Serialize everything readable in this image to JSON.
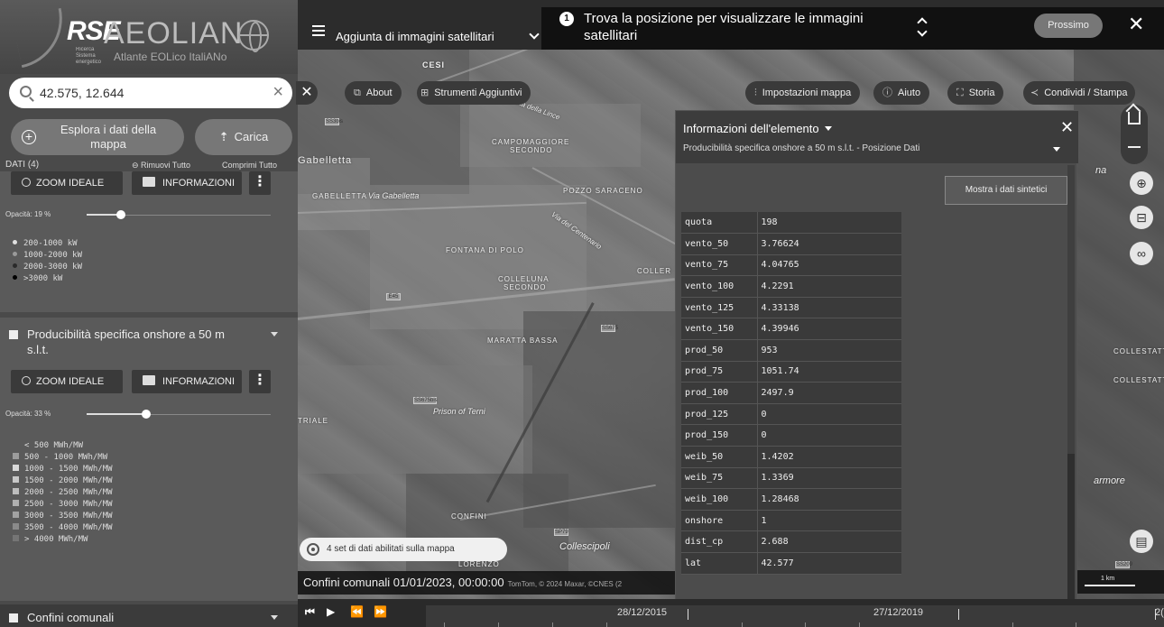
{
  "logo": {
    "brand": "RSE",
    "name": "AEOLIAN",
    "subtitle": "Atlante EOLico ItaliANo",
    "tagline": "Ricerca Sistema energetico"
  },
  "search": {
    "value": "42.575, 12.644",
    "clear_icon": "close-icon"
  },
  "actions": {
    "explore_label": "Esplora i dati della mappa",
    "upload_label": "Carica"
  },
  "data_header": {
    "count_label": "DATI (4)",
    "remove_all": "Rimuovi Tutto",
    "collapse_all": "Comprimi Tutto"
  },
  "layers": [
    {
      "zoom_label": "ZOOM IDEALE",
      "info_label": "INFORMAZIONI",
      "opacity_label": "Opacità: 19 %",
      "opacity": 0.19,
      "legend": [
        {
          "label": "200-1000 kW",
          "color": "#e0e0e0"
        },
        {
          "label": "1000-2000 kW",
          "color": "#9a9a9a"
        },
        {
          "label": "2000-3000 kW",
          "color": "#555555"
        },
        {
          "label": ">3000 kW",
          "color": "#111111"
        }
      ]
    },
    {
      "title": "Producibilità specifica onshore a 50 m s.l.t.",
      "zoom_label": "ZOOM IDEALE",
      "info_label": "INFORMAZIONI",
      "opacity_label": "Opacità: 33 %",
      "opacity": 0.33,
      "legend": [
        {
          "label": "< 500 MWh/MW",
          "color": "#5a5a5a"
        },
        {
          "label": "500 - 1000 MWh/MW",
          "color": "#9c9c9c"
        },
        {
          "label": "1000 - 1500 MWh/MW",
          "color": "#d8d8d8"
        },
        {
          "label": "1500 - 2000 MWh/MW",
          "color": "#c8c8c8"
        },
        {
          "label": "2000 - 2500 MWh/MW",
          "color": "#bdbdbd"
        },
        {
          "label": "2500 - 3000 MWh/MW",
          "color": "#b0b0b0"
        },
        {
          "label": "3000 - 3500 MWh/MW",
          "color": "#a2a2a2"
        },
        {
          "label": "3500 - 4000 MWh/MW",
          "color": "#8a8a8a"
        },
        {
          "label": "> 4000 MWh/MW",
          "color": "#757575"
        }
      ]
    },
    {
      "title": "Confini comunali"
    }
  ],
  "topbar": {
    "layer_title": "Aggiunta di immagini satellitari"
  },
  "tour": {
    "step": "1",
    "message": "Trova la posizione per visualizzare le immagini satellitari",
    "next_label": "Prossimo"
  },
  "map_toolbar": {
    "about": "About",
    "tools": "Strumenti Aggiuntivi",
    "map_settings": "Impostazioni mappa",
    "help": "Aiuto",
    "history": "Storia",
    "share": "Condividi / Stampa"
  },
  "places": {
    "cesi": "CESI",
    "gabelletta_w": "Gabelletta",
    "gabelletta_caps": "GABELLETTA",
    "gabelletta_it": "Via Gabelletta",
    "campomaggiore": "CAMPOMAGGIORE",
    "campomaggiore2": "SECONDO",
    "pozzo": "POZZO SARACENO",
    "fontana": "FONTANA DI POLO",
    "colleluna": "COLLELUNA",
    "colleluna2": "SECONDO",
    "coller": "COLLER",
    "maratta": "MARATTA BASSA",
    "prison": "Prison of Terni",
    "confini": "CONFINI",
    "collescipoli": "Collescipoli",
    "lorenzo": "LORENZO",
    "collestatte": "COLLESTATTE",
    "collestatte2": "COLLESTATTE P",
    "marmore": "armore",
    "triale": "TRIALE",
    "na": "na",
    "via_lince": "Via della Lince",
    "via_centenario": "Via del Centenario",
    "shield1": "SS3bis",
    "shield2": "E45",
    "shield3": "SS675bis",
    "shield4": "SS675",
    "shield5": "SP79",
    "shield6": "SS209"
  },
  "info_panel": {
    "title": "Informazioni dell'elemento",
    "subtitle": "Producibilità specifica onshore a 50 m s.l.t. - Posizione Dati",
    "synthetic_button": "Mostra i dati sintetici",
    "rows": [
      {
        "key": "quota",
        "value": "198"
      },
      {
        "key": "vento_50",
        "value": "3.76624"
      },
      {
        "key": "vento_75",
        "value": "4.04765"
      },
      {
        "key": "vento_100",
        "value": "4.2291"
      },
      {
        "key": "vento_125",
        "value": "4.33138"
      },
      {
        "key": "vento_150",
        "value": "4.39946"
      },
      {
        "key": "prod_50",
        "value": "953"
      },
      {
        "key": "prod_75",
        "value": "1051.74"
      },
      {
        "key": "prod_100",
        "value": "2497.9"
      },
      {
        "key": "prod_125",
        "value": "0"
      },
      {
        "key": "prod_150",
        "value": "0"
      },
      {
        "key": "weib_50",
        "value": "1.4202"
      },
      {
        "key": "weib_75",
        "value": "1.3369"
      },
      {
        "key": "weib_100",
        "value": "1.28468"
      },
      {
        "key": "onshore",
        "value": "1"
      },
      {
        "key": "dist_cp",
        "value": "2.688"
      },
      {
        "key": "lat",
        "value": "42.577"
      }
    ]
  },
  "status": {
    "datasets": "4 set di dati abilitati sulla mappa",
    "layer_time": "Confini comunali 01/01/2023, 00:00:00",
    "attribution": "TomTom, © 2024 Maxar, ©CNES (2"
  },
  "scale": {
    "label": "1 km"
  },
  "timeline": {
    "date1": "28/12/2015",
    "date2": "27/12/2019",
    "date3": "2("
  }
}
